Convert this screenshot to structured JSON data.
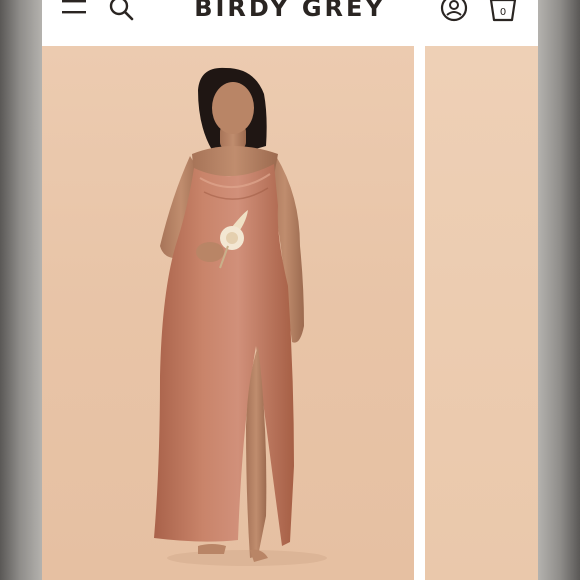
{
  "header": {
    "brand": "BIRDY GREY",
    "menu_icon": "hamburger-menu-icon",
    "search_icon": "search-icon",
    "account_icon": "account-icon",
    "bag_icon": "shopping-bag-icon",
    "bag_count": "0"
  },
  "gallery": {
    "main_image": "model-in-terracotta-satin-slip-dress-photo",
    "next_image": "next-product-photo-preview"
  },
  "colors": {
    "background": "#eac8ab",
    "dress": "#c27a5e",
    "brand_text": "#2a2522"
  }
}
